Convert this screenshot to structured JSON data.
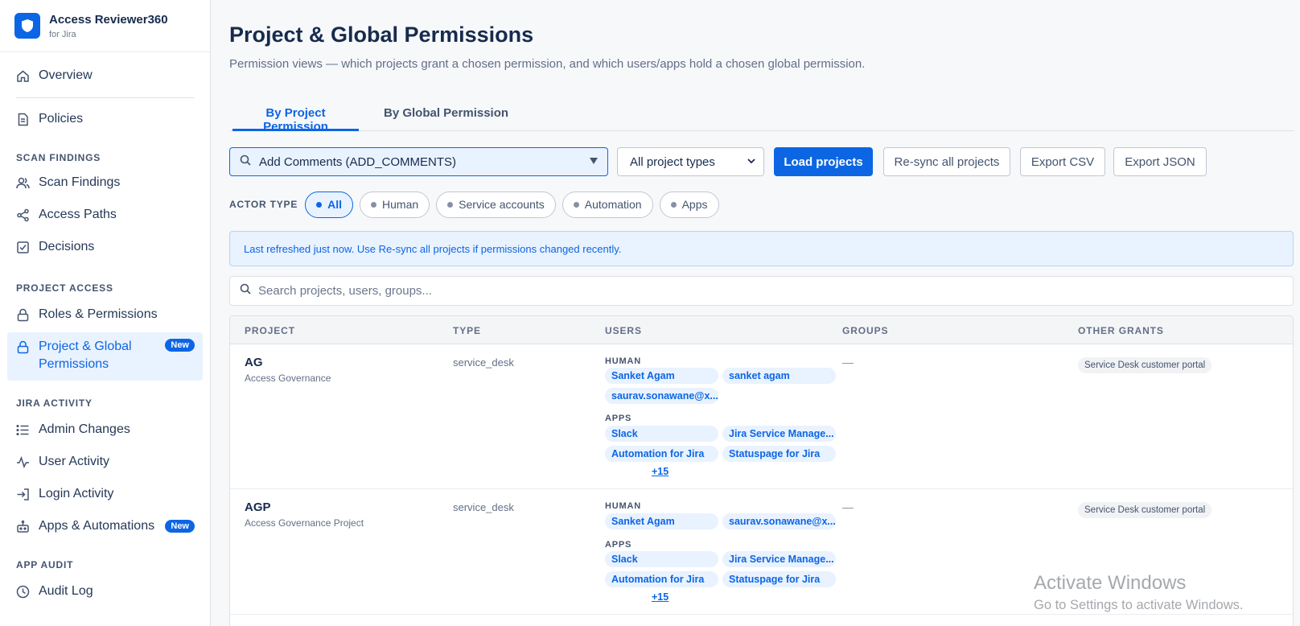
{
  "brand": {
    "title": "Access Reviewer360",
    "subtitle": "for Jira"
  },
  "sidebar": {
    "items": {
      "overview": "Overview",
      "policies": "Policies",
      "scan_findings": "Scan Findings",
      "access_paths": "Access Paths",
      "decisions": "Decisions",
      "roles_permissions": "Roles & Permissions",
      "project_global_line1": "Project & Global",
      "project_global_line2": "Permissions",
      "admin_changes": "Admin Changes",
      "user_activity": "User Activity",
      "login_activity": "Login Activity",
      "apps_automations": "Apps & Automations",
      "audit_log": "Audit Log"
    },
    "sections": {
      "scan_findings": "SCAN FINDINGS",
      "project_access": "PROJECT ACCESS",
      "jira_activity": "JIRA ACTIVITY",
      "app_audit": "APP AUDIT"
    },
    "badge_new": "New"
  },
  "page": {
    "title": "Project & Global Permissions",
    "description": "Permission views — which projects grant a chosen permission, and which users/apps hold a chosen global permission."
  },
  "tabs": {
    "by_project": "By Project Permission",
    "by_global": "By Global Permission"
  },
  "toolbar": {
    "permission_select": "Add Comments (ADD_COMMENTS)",
    "project_types_select": "All project types",
    "load_projects": "Load projects",
    "resync": "Re-sync all projects",
    "export_csv": "Export CSV",
    "export_json": "Export JSON"
  },
  "actor_filter": {
    "label": "ACTOR TYPE",
    "options": [
      "All",
      "Human",
      "Service accounts",
      "Automation",
      "Apps"
    ],
    "selected": "All"
  },
  "banner": "Last refreshed just now. Use Re-sync all projects if permissions changed recently.",
  "search": {
    "placeholder": "Search projects, users, groups..."
  },
  "table": {
    "headers": [
      "PROJECT",
      "TYPE",
      "USERS",
      "GROUPS",
      "OTHER GRANTS"
    ],
    "rows": [
      {
        "key": "AG",
        "name": "Access Governance",
        "type": "service_desk",
        "human_label": "HUMAN",
        "humans": [
          "Sanket Agam",
          "sanket agam",
          "saurav.sonawane@x..."
        ],
        "apps_label": "APPS",
        "apps": [
          "Slack",
          "Jira Service Manage...",
          "Automation for Jira",
          "Statuspage for Jira"
        ],
        "more": "+15",
        "groups": "—",
        "other_grants": "Service Desk customer portal"
      },
      {
        "key": "AGP",
        "name": "Access Governance Project",
        "type": "service_desk",
        "human_label": "HUMAN",
        "humans": [
          "Sanket Agam",
          "saurav.sonawane@x..."
        ],
        "apps_label": "APPS",
        "apps": [
          "Slack",
          "Jira Service Manage...",
          "Automation for Jira",
          "Statuspage for Jira"
        ],
        "more": "+15",
        "groups": "—",
        "other_grants": "Service Desk customer portal"
      }
    ]
  },
  "watermark": {
    "line1": "Activate Windows",
    "line2": "Go to Settings to activate Windows."
  }
}
